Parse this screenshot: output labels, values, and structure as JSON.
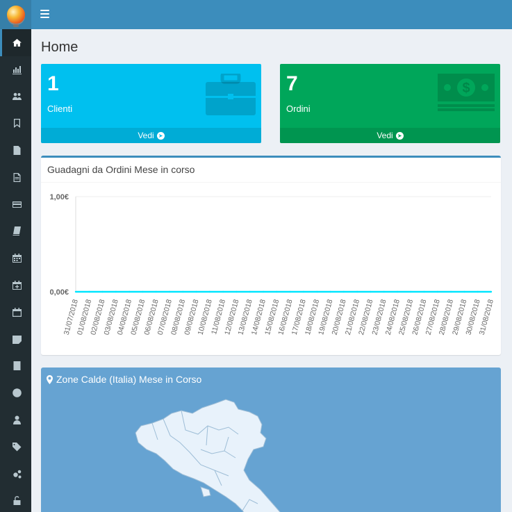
{
  "sidebar": {
    "items": [
      {
        "icon": "home-icon",
        "active": true
      },
      {
        "icon": "bar-chart-icon"
      },
      {
        "icon": "users-icon"
      },
      {
        "icon": "bookmark-icon"
      },
      {
        "icon": "file-text-icon"
      },
      {
        "icon": "file-text-outline-icon"
      },
      {
        "icon": "credit-card-icon"
      },
      {
        "icon": "book-icon"
      },
      {
        "icon": "calendar-icon"
      },
      {
        "icon": "calendar-plus-icon"
      },
      {
        "icon": "calendar-outline-icon"
      },
      {
        "icon": "sticky-note-icon"
      },
      {
        "icon": "address-book-icon"
      },
      {
        "icon": "globe-icon"
      },
      {
        "icon": "user-icon"
      },
      {
        "icon": "tags-icon"
      },
      {
        "icon": "cogs-icon"
      },
      {
        "icon": "unlock-icon"
      }
    ]
  },
  "page": {
    "title": "Home"
  },
  "boxes": [
    {
      "number": "1",
      "label": "Clienti",
      "link": "Vedi",
      "icon": "briefcase-icon",
      "color": "#00c0ef"
    },
    {
      "number": "7",
      "label": "Ordini",
      "link": "Vedi",
      "icon": "money-icon",
      "color": "#00a65a"
    }
  ],
  "earnings": {
    "title": "Guadagni da Ordini Mese in corso"
  },
  "chart_data": {
    "type": "line",
    "ylim": [
      0,
      1
    ],
    "y_ticks": [
      "1,00€",
      "0,00€"
    ],
    "categories": [
      "31/07/2018",
      "01/08/2018",
      "02/08/2018",
      "03/08/2018",
      "04/08/2018",
      "05/08/2018",
      "06/08/2018",
      "07/08/2018",
      "08/08/2018",
      "09/08/2018",
      "10/08/2018",
      "11/08/2018",
      "12/08/2018",
      "13/08/2018",
      "14/08/2018",
      "15/08/2018",
      "16/08/2018",
      "17/08/2018",
      "18/08/2018",
      "19/08/2018",
      "20/08/2018",
      "21/08/2018",
      "22/08/2018",
      "23/08/2018",
      "24/08/2018",
      "25/08/2018",
      "26/08/2018",
      "27/08/2018",
      "28/08/2018",
      "29/08/2018",
      "30/08/2018",
      "31/08/2018"
    ],
    "series": [
      {
        "values": [
          0,
          0,
          0,
          0,
          0,
          0,
          0,
          0,
          0,
          0,
          0,
          0,
          0,
          0,
          0,
          0,
          0,
          0,
          0,
          0,
          0,
          0,
          0,
          0,
          0,
          0,
          0,
          0,
          0,
          0,
          0,
          0
        ],
        "color": "#00e5ff"
      }
    ],
    "grid": true
  },
  "map": {
    "title": "Zone Calde (Italia) Mese in Corso",
    "icon": "map-marker-icon"
  }
}
